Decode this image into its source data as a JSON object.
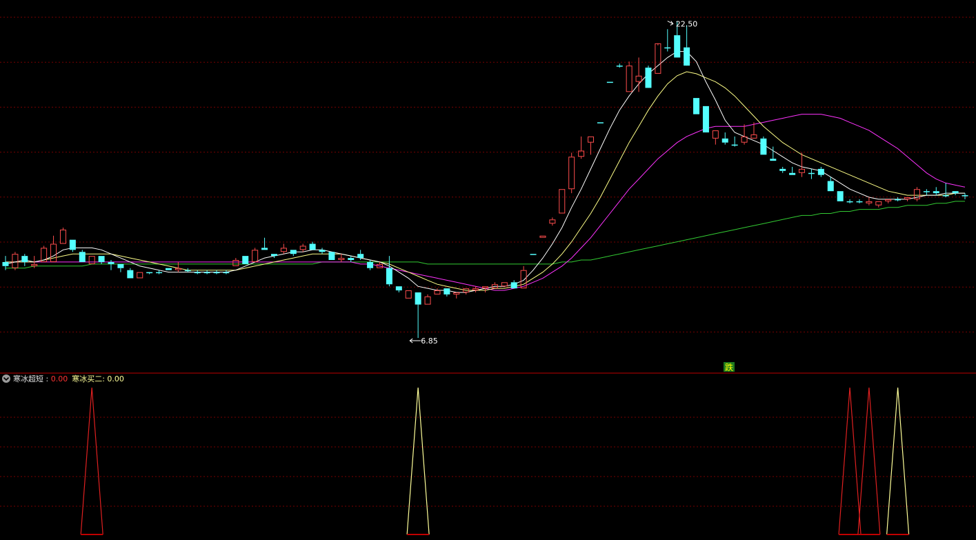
{
  "window_title": "",
  "price_panel": {
    "high_label": "22.50",
    "low_label": "6.85",
    "signal_label": "跌"
  },
  "indicator_panel": {
    "name": "寒冰超短",
    "sep": " : ",
    "value1": "0.00",
    "label2": "寒冰买二",
    "value2": "0.00"
  },
  "colors": {
    "background": "#000000",
    "grid": "#7a0000",
    "panel_divider": "#c00000",
    "up_candle": "#ff4d4d",
    "down_candle": "#54ffff",
    "ma5": "#ffffff",
    "ma10": "#ffff88",
    "ma30": "#ff33ff",
    "ma60": "#33cc33",
    "signal_red": "#e02020",
    "signal_yellow": "#ffff99",
    "signal_badge_bg": "#1f7a1f",
    "signal_badge_text": "#ffff00"
  },
  "chart_data": [
    {
      "type": "candlestick",
      "title": "",
      "ylim": [
        6.0,
        23.2
      ],
      "grid": true,
      "highest": {
        "index": 69,
        "value": 22.5
      },
      "lowest": {
        "index": 42,
        "value": 6.85
      },
      "candles": [
        [
          10.6,
          10.9,
          10.2,
          10.4
        ],
        [
          10.3,
          11.1,
          10.2,
          11.0
        ],
        [
          10.9,
          11.0,
          10.4,
          10.6
        ],
        [
          10.4,
          10.9,
          10.3,
          10.5
        ],
        [
          10.6,
          11.4,
          10.6,
          11.3
        ],
        [
          10.6,
          11.9,
          10.6,
          11.5
        ],
        [
          11.5,
          12.3,
          11.5,
          12.2
        ],
        [
          11.7,
          11.7,
          11.1,
          11.2
        ],
        [
          11.1,
          11.2,
          10.6,
          10.6
        ],
        [
          10.5,
          10.9,
          10.5,
          10.9
        ],
        [
          10.9,
          10.9,
          10.5,
          10.6
        ],
        [
          10.6,
          10.7,
          10.2,
          10.5
        ],
        [
          10.5,
          10.5,
          10.1,
          10.3
        ],
        [
          10.2,
          10.3,
          9.8,
          9.8
        ],
        [
          9.8,
          10.1,
          9.8,
          10.1
        ],
        [
          10.1,
          10.1,
          10.0,
          10.1
        ],
        [
          10.1,
          10.2,
          10.0,
          10.1
        ],
        [
          10.3,
          10.3,
          10.2,
          10.2
        ],
        [
          10.2,
          10.6,
          10.1,
          10.3
        ],
        [
          10.2,
          10.3,
          10.1,
          10.2
        ],
        [
          10.1,
          10.2,
          10.0,
          10.1
        ],
        [
          10.1,
          10.2,
          10.0,
          10.1
        ],
        [
          10.1,
          10.2,
          10.0,
          10.1
        ],
        [
          10.1,
          10.2,
          10.0,
          10.1
        ],
        [
          10.4,
          10.8,
          10.4,
          10.7
        ],
        [
          10.9,
          10.9,
          10.5,
          10.5
        ],
        [
          10.6,
          11.3,
          10.6,
          11.2
        ],
        [
          11.3,
          11.8,
          11.2,
          11.2
        ],
        [
          11.0,
          11.0,
          10.8,
          10.9
        ],
        [
          11.1,
          11.5,
          11.0,
          11.3
        ],
        [
          11.2,
          11.2,
          10.9,
          11.0
        ],
        [
          11.2,
          11.5,
          11.1,
          11.4
        ],
        [
          11.5,
          11.6,
          11.2,
          11.2
        ],
        [
          11.2,
          11.3,
          11.0,
          11.1
        ],
        [
          11.1,
          11.1,
          10.7,
          10.7
        ],
        [
          10.7,
          11.0,
          10.6,
          10.8
        ],
        [
          10.8,
          10.9,
          10.6,
          10.7
        ],
        [
          11.0,
          11.2,
          10.7,
          10.8
        ],
        [
          10.6,
          10.7,
          10.2,
          10.3
        ],
        [
          10.3,
          10.6,
          10.3,
          10.5
        ],
        [
          10.3,
          10.9,
          9.4,
          9.5
        ],
        [
          9.4,
          9.4,
          9.1,
          9.2
        ],
        [
          8.8,
          9.2,
          8.8,
          9.2
        ],
        [
          9.1,
          9.1,
          6.85,
          8.5
        ],
        [
          8.5,
          9.0,
          8.5,
          8.9
        ],
        [
          9.0,
          9.3,
          9.0,
          9.2
        ],
        [
          9.3,
          9.3,
          8.9,
          9.0
        ],
        [
          9.0,
          9.1,
          8.8,
          9.1
        ],
        [
          9.1,
          9.3,
          9.0,
          9.3
        ],
        [
          9.2,
          9.4,
          9.1,
          9.3
        ],
        [
          9.3,
          9.4,
          9.1,
          9.4
        ],
        [
          9.3,
          9.6,
          9.3,
          9.5
        ],
        [
          9.4,
          9.6,
          9.4,
          9.6
        ],
        [
          9.6,
          9.7,
          9.3,
          9.3
        ],
        [
          9.3,
          10.4,
          9.3,
          10.2
        ],
        [
          11.0,
          11.0,
          11.0,
          11.0
        ],
        [
          11.8,
          11.9,
          11.8,
          11.9
        ],
        [
          12.5,
          12.8,
          12.4,
          12.7
        ],
        [
          13.0,
          14.2,
          13.0,
          14.2
        ],
        [
          14.2,
          16.0,
          14.0,
          15.8
        ],
        [
          15.8,
          16.8,
          15.7,
          16.1
        ],
        [
          16.5,
          16.8,
          15.9,
          16.8
        ],
        [
          17.5,
          17.5,
          17.5,
          17.5
        ],
        [
          19.5,
          19.5,
          19.5,
          19.5
        ],
        [
          20.3,
          20.4,
          20.2,
          20.3
        ],
        [
          19.0,
          20.5,
          19.0,
          20.3
        ],
        [
          19.5,
          20.7,
          19.0,
          19.8
        ],
        [
          20.2,
          20.3,
          19.3,
          19.2
        ],
        [
          19.9,
          21.3,
          19.9,
          21.4
        ],
        [
          21.2,
          22.1,
          21.0,
          21.2
        ],
        [
          21.8,
          22.5,
          20.7,
          20.7
        ],
        [
          21.2,
          22.3,
          20.5,
          20.3
        ],
        [
          18.7,
          18.7,
          17.9,
          17.9
        ],
        [
          18.3,
          18.3,
          17.0,
          17.0
        ],
        [
          16.7,
          17.1,
          16.4,
          17.1
        ],
        [
          16.7,
          17.0,
          16.4,
          16.5
        ],
        [
          16.4,
          16.8,
          16.3,
          16.4
        ],
        [
          16.5,
          17.4,
          16.4,
          16.8
        ],
        [
          16.7,
          17.5,
          16.7,
          16.9
        ],
        [
          16.7,
          16.8,
          15.9,
          15.9
        ],
        [
          15.7,
          16.3,
          15.6,
          15.6
        ],
        [
          15.2,
          15.3,
          15.0,
          15.1
        ],
        [
          15.0,
          15.3,
          14.9,
          14.9
        ],
        [
          15.0,
          16.0,
          14.8,
          15.2
        ],
        [
          15.0,
          15.2,
          14.7,
          15.0
        ],
        [
          15.2,
          15.3,
          14.8,
          14.9
        ],
        [
          14.6,
          14.8,
          14.1,
          14.1
        ],
        [
          14.1,
          14.1,
          13.6,
          13.6
        ],
        [
          13.6,
          13.7,
          13.5,
          13.6
        ],
        [
          13.6,
          13.7,
          13.5,
          13.6
        ],
        [
          13.5,
          13.8,
          13.4,
          13.6
        ],
        [
          13.4,
          13.6,
          13.3,
          13.6
        ],
        [
          13.6,
          13.7,
          13.5,
          13.7
        ],
        [
          13.7,
          13.8,
          13.6,
          13.7
        ],
        [
          13.7,
          13.8,
          13.6,
          13.8
        ],
        [
          13.7,
          14.3,
          13.6,
          14.2
        ],
        [
          14.1,
          14.2,
          13.9,
          14.1
        ],
        [
          14.1,
          14.3,
          13.9,
          14.0
        ],
        [
          13.9,
          14.5,
          13.8,
          13.9
        ],
        [
          14.1,
          14.1,
          13.9,
          14.0
        ],
        [
          13.9,
          14.0,
          13.7,
          13.9
        ]
      ],
      "ma5": [
        10.5,
        10.6,
        10.7,
        10.6,
        10.7,
        10.9,
        11.2,
        11.3,
        11.3,
        11.3,
        11.2,
        11.0,
        10.8,
        10.6,
        10.4,
        10.3,
        10.2,
        10.1,
        10.1,
        10.1,
        10.1,
        10.1,
        10.1,
        10.1,
        10.2,
        10.4,
        10.6,
        10.8,
        10.9,
        11.0,
        11.1,
        11.1,
        11.2,
        11.2,
        11.1,
        11.0,
        10.9,
        10.8,
        10.7,
        10.6,
        10.4,
        10.1,
        9.8,
        9.4,
        9.3,
        9.2,
        9.2,
        9.1,
        9.1,
        9.2,
        9.3,
        9.4,
        9.4,
        9.5,
        9.7,
        10.2,
        10.8,
        11.5,
        12.3,
        13.3,
        14.2,
        15.2,
        16.2,
        17.2,
        18.1,
        18.8,
        19.4,
        19.9,
        20.3,
        20.7,
        21.0,
        21.0,
        20.5,
        19.5,
        18.6,
        17.6,
        17.0,
        16.8,
        16.6,
        16.4,
        16.1,
        15.8,
        15.5,
        15.3,
        15.2,
        15.1,
        14.8,
        14.5,
        14.2,
        14.0,
        13.8,
        13.7,
        13.7,
        13.7,
        13.7,
        13.8,
        13.9,
        13.9,
        14.0,
        14.0,
        14.0
      ],
      "ma10": [
        10.6,
        10.6,
        10.6,
        10.6,
        10.7,
        10.8,
        10.9,
        11.0,
        11.0,
        11.0,
        11.0,
        11.0,
        10.9,
        10.8,
        10.7,
        10.6,
        10.5,
        10.4,
        10.3,
        10.2,
        10.2,
        10.2,
        10.2,
        10.2,
        10.2,
        10.3,
        10.4,
        10.5,
        10.6,
        10.7,
        10.8,
        10.9,
        11.0,
        11.0,
        11.0,
        11.0,
        10.9,
        10.8,
        10.7,
        10.6,
        10.5,
        10.3,
        10.1,
        9.9,
        9.7,
        9.5,
        9.4,
        9.3,
        9.2,
        9.2,
        9.2,
        9.3,
        9.3,
        9.4,
        9.5,
        9.8,
        10.1,
        10.5,
        11.0,
        11.6,
        12.3,
        13.0,
        13.8,
        14.7,
        15.6,
        16.5,
        17.3,
        18.1,
        18.8,
        19.4,
        19.8,
        20.0,
        19.9,
        19.7,
        19.5,
        19.2,
        18.8,
        18.3,
        17.8,
        17.3,
        16.9,
        16.5,
        16.2,
        15.9,
        15.7,
        15.5,
        15.3,
        15.1,
        14.9,
        14.7,
        14.5,
        14.3,
        14.1,
        14.0,
        13.9,
        13.9,
        13.9,
        13.9,
        13.9,
        14.0,
        14.0
      ],
      "ma30": [
        10.6,
        10.6,
        10.6,
        10.6,
        10.6,
        10.6,
        10.6,
        10.6,
        10.6,
        10.6,
        10.6,
        10.6,
        10.6,
        10.6,
        10.6,
        10.6,
        10.6,
        10.6,
        10.6,
        10.6,
        10.6,
        10.6,
        10.6,
        10.6,
        10.6,
        10.6,
        10.6,
        10.6,
        10.6,
        10.6,
        10.6,
        10.6,
        10.6,
        10.6,
        10.6,
        10.6,
        10.6,
        10.5,
        10.5,
        10.4,
        10.3,
        10.2,
        10.1,
        10.0,
        9.9,
        9.8,
        9.7,
        9.6,
        9.5,
        9.4,
        9.3,
        9.2,
        9.2,
        9.3,
        9.4,
        9.6,
        9.8,
        10.1,
        10.4,
        10.8,
        11.3,
        11.8,
        12.4,
        13.0,
        13.6,
        14.2,
        14.7,
        15.2,
        15.7,
        16.1,
        16.5,
        16.8,
        17.0,
        17.2,
        17.3,
        17.3,
        17.3,
        17.3,
        17.4,
        17.5,
        17.6,
        17.7,
        17.8,
        17.9,
        17.9,
        17.9,
        17.8,
        17.7,
        17.5,
        17.3,
        17.1,
        16.8,
        16.5,
        16.2,
        15.8,
        15.4,
        15.0,
        14.7,
        14.5,
        14.4,
        14.3
      ],
      "ma60": [
        10.3,
        10.3,
        10.3,
        10.4,
        10.4,
        10.4,
        10.4,
        10.4,
        10.4,
        10.5,
        10.5,
        10.5,
        10.5,
        10.5,
        10.5,
        10.5,
        10.5,
        10.5,
        10.5,
        10.5,
        10.5,
        10.5,
        10.5,
        10.5,
        10.5,
        10.5,
        10.5,
        10.5,
        10.5,
        10.5,
        10.5,
        10.5,
        10.5,
        10.6,
        10.6,
        10.6,
        10.6,
        10.6,
        10.6,
        10.6,
        10.6,
        10.6,
        10.6,
        10.6,
        10.5,
        10.5,
        10.5,
        10.5,
        10.5,
        10.5,
        10.5,
        10.5,
        10.5,
        10.5,
        10.5,
        10.5,
        10.5,
        10.5,
        10.6,
        10.6,
        10.7,
        10.7,
        10.8,
        10.9,
        11.0,
        11.1,
        11.2,
        11.3,
        11.4,
        11.5,
        11.6,
        11.7,
        11.8,
        11.9,
        12.0,
        12.1,
        12.2,
        12.3,
        12.4,
        12.5,
        12.6,
        12.7,
        12.8,
        12.9,
        12.9,
        13.0,
        13.0,
        13.1,
        13.1,
        13.2,
        13.2,
        13.2,
        13.3,
        13.3,
        13.4,
        13.4,
        13.4,
        13.5,
        13.5,
        13.6,
        13.6
      ]
    },
    {
      "type": "spike",
      "title": "寒冰超短",
      "ylim": [
        0,
        1
      ],
      "grid": true,
      "series": [
        {
          "name": "寒冰超短",
          "spikes": [
            [
              9,
              1
            ],
            [
              88,
              1
            ],
            [
              90,
              1
            ]
          ]
        },
        {
          "name": "寒冰买二",
          "spikes": [
            [
              43,
              1
            ],
            [
              93,
              1
            ]
          ]
        }
      ]
    }
  ]
}
